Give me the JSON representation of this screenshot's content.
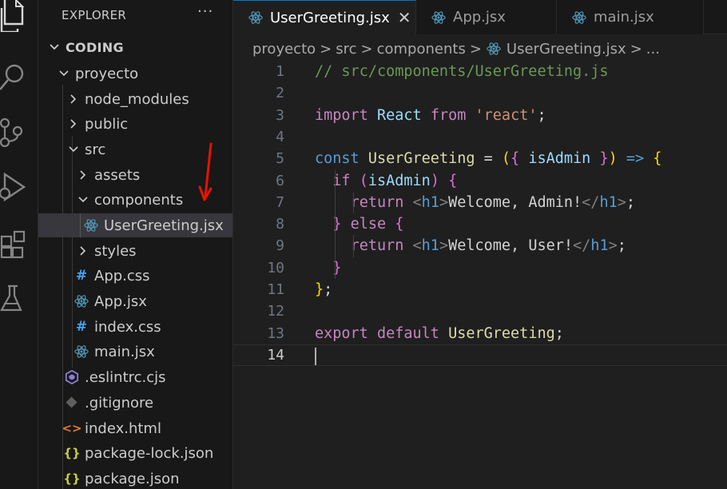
{
  "sidebar": {
    "title": "EXPLORER",
    "more_label": "···",
    "section": "CODING",
    "tree": [
      {
        "label": "proyecto",
        "kind": "folder-open"
      },
      {
        "label": "node_modules",
        "kind": "folder"
      },
      {
        "label": "public",
        "kind": "folder"
      },
      {
        "label": "src",
        "kind": "folder-open"
      },
      {
        "label": "assets",
        "kind": "folder"
      },
      {
        "label": "components",
        "kind": "folder-open"
      },
      {
        "label": "UserGreeting.jsx",
        "kind": "react-icon"
      },
      {
        "label": "styles",
        "kind": "folder"
      },
      {
        "label": "App.css",
        "kind": "css-icon",
        "icon_text": "#"
      },
      {
        "label": "App.jsx",
        "kind": "react-icon"
      },
      {
        "label": "index.css",
        "kind": "css-icon",
        "icon_text": "#"
      },
      {
        "label": "main.jsx",
        "kind": "react-icon"
      },
      {
        "label": ".eslintrc.cjs",
        "kind": "eslint-icon"
      },
      {
        "label": ".gitignore",
        "kind": "git-icon"
      },
      {
        "label": "index.html",
        "kind": "html-icon",
        "icon_text": "<>"
      },
      {
        "label": "package-lock.json",
        "kind": "json-icon",
        "icon_text": "{}"
      },
      {
        "label": "package.json",
        "kind": "json-icon",
        "icon_text": "{}"
      }
    ]
  },
  "tabs": [
    {
      "label": "UserGreeting.jsx",
      "active": true,
      "close": "✕"
    },
    {
      "label": "App.jsx",
      "active": false
    },
    {
      "label": "main.jsx",
      "active": false
    }
  ],
  "breadcrumb": [
    "proyecto",
    "src",
    "components",
    "UserGreeting.jsx",
    "..."
  ],
  "breadcrumb_sep": ">",
  "editor": {
    "line_numbers": [
      "1",
      "2",
      "3",
      "4",
      "5",
      "6",
      "7",
      "8",
      "9",
      "10",
      "11",
      "12",
      "13",
      "14"
    ],
    "current_line": "14",
    "lines": [
      [
        {
          "t": "// src/components/UserGreeting.js",
          "c": "c-com"
        }
      ],
      [],
      [
        {
          "t": "import",
          "c": "c-kw"
        },
        {
          "t": " ",
          "c": "c-pl"
        },
        {
          "t": "React",
          "c": "c-react"
        },
        {
          "t": " ",
          "c": "c-pl"
        },
        {
          "t": "from",
          "c": "c-kw"
        },
        {
          "t": " ",
          "c": "c-pl"
        },
        {
          "t": "'react'",
          "c": "c-str"
        },
        {
          "t": ";",
          "c": "c-pl"
        }
      ],
      [],
      [
        {
          "t": "const",
          "c": "c-decl"
        },
        {
          "t": " ",
          "c": "c-pl"
        },
        {
          "t": "UserGreeting",
          "c": "c-fn"
        },
        {
          "t": " = ",
          "c": "c-pl"
        },
        {
          "t": "(",
          "c": "c-b1"
        },
        {
          "t": "{",
          "c": "c-b2"
        },
        {
          "t": " ",
          "c": "c-pl"
        },
        {
          "t": "isAdmin",
          "c": "c-id"
        },
        {
          "t": " ",
          "c": "c-pl"
        },
        {
          "t": "}",
          "c": "c-b2"
        },
        {
          "t": ")",
          "c": "c-b1"
        },
        {
          "t": " ",
          "c": "c-pl"
        },
        {
          "t": "=>",
          "c": "c-decl"
        },
        {
          "t": " ",
          "c": "c-pl"
        },
        {
          "t": "{",
          "c": "c-b1"
        }
      ],
      [
        {
          "t": "  ",
          "c": "c-pl"
        },
        {
          "t": "if",
          "c": "c-kw"
        },
        {
          "t": " ",
          "c": "c-pl"
        },
        {
          "t": "(",
          "c": "c-b2"
        },
        {
          "t": "isAdmin",
          "c": "c-id"
        },
        {
          "t": ")",
          "c": "c-b2"
        },
        {
          "t": " ",
          "c": "c-pl"
        },
        {
          "t": "{",
          "c": "c-b2"
        }
      ],
      [
        {
          "t": "    ",
          "c": "c-pl"
        },
        {
          "t": "return",
          "c": "c-kw"
        },
        {
          "t": " ",
          "c": "c-pl"
        },
        {
          "t": "<",
          "c": "c-tb"
        },
        {
          "t": "h1",
          "c": "c-tag"
        },
        {
          "t": ">",
          "c": "c-tb"
        },
        {
          "t": "Welcome, Admin!",
          "c": "c-pl"
        },
        {
          "t": "</",
          "c": "c-tb"
        },
        {
          "t": "h1",
          "c": "c-tag"
        },
        {
          "t": ">",
          "c": "c-tb"
        },
        {
          "t": ";",
          "c": "c-pl"
        }
      ],
      [
        {
          "t": "  ",
          "c": "c-pl"
        },
        {
          "t": "}",
          "c": "c-b2"
        },
        {
          "t": " ",
          "c": "c-pl"
        },
        {
          "t": "else",
          "c": "c-kw"
        },
        {
          "t": " ",
          "c": "c-pl"
        },
        {
          "t": "{",
          "c": "c-b2"
        }
      ],
      [
        {
          "t": "    ",
          "c": "c-pl"
        },
        {
          "t": "return",
          "c": "c-kw"
        },
        {
          "t": " ",
          "c": "c-pl"
        },
        {
          "t": "<",
          "c": "c-tb"
        },
        {
          "t": "h1",
          "c": "c-tag"
        },
        {
          "t": ">",
          "c": "c-tb"
        },
        {
          "t": "Welcome, User!",
          "c": "c-pl"
        },
        {
          "t": "</",
          "c": "c-tb"
        },
        {
          "t": "h1",
          "c": "c-tag"
        },
        {
          "t": ">",
          "c": "c-tb"
        },
        {
          "t": ";",
          "c": "c-pl"
        }
      ],
      [
        {
          "t": "  ",
          "c": "c-pl"
        },
        {
          "t": "}",
          "c": "c-b2"
        }
      ],
      [
        {
          "t": "}",
          "c": "c-b1"
        },
        {
          "t": ";",
          "c": "c-pl"
        }
      ],
      [],
      [
        {
          "t": "export",
          "c": "c-kw"
        },
        {
          "t": " ",
          "c": "c-pl"
        },
        {
          "t": "default",
          "c": "c-kw"
        },
        {
          "t": " ",
          "c": "c-pl"
        },
        {
          "t": "UserGreeting",
          "c": "c-fn"
        },
        {
          "t": ";",
          "c": "c-pl"
        }
      ],
      []
    ]
  },
  "colors": {
    "accent": "#0078d4",
    "react_icon": "#519aba",
    "annotation_arrow": "#e51400"
  },
  "annotation": {
    "icon": "red-arrow-down"
  }
}
